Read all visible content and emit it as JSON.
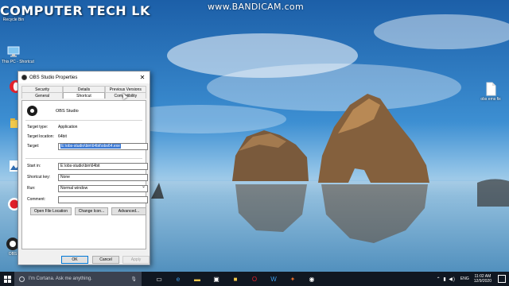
{
  "watermark": "COMPUTER TECH LK",
  "recorder_watermark": "www.BANDICAM.com",
  "desktop": {
    "icons": [
      {
        "label": "Recycle Bin"
      },
      {
        "label": "This PC - Shortcut"
      },
      {
        "label": "obs ems fix"
      }
    ]
  },
  "dialog": {
    "title": "OBS Studio Properties",
    "close_glyph": "✕",
    "tabs_row1": [
      "Security",
      "Details",
      "Previous Versions"
    ],
    "tabs_row2": [
      "General",
      "Shortcut",
      "Compatibility"
    ],
    "active_tab": "Compatibility",
    "app_name": "OBS Studio",
    "target_type_label": "Target type:",
    "target_type_value": "Application",
    "target_location_label": "Target location:",
    "target_location_value": "64bit",
    "target_label": "Target:",
    "target_value": "E:\\obs-studio\\bin\\64bit\\obs64.exe",
    "start_in_label": "Start in:",
    "start_in_value": "E:\\obs-studio\\bin\\64bit",
    "shortcut_key_label": "Shortcut key:",
    "shortcut_key_value": "None",
    "run_label": "Run:",
    "run_value": "Normal window",
    "comment_label": "Comment:",
    "comment_value": "",
    "open_file_location": "Open File Location",
    "change_icon": "Change Icon...",
    "advanced": "Advanced...",
    "ok": "OK",
    "cancel": "Cancel",
    "apply": "Apply"
  },
  "taskbar": {
    "search_placeholder": "I'm Cortana. Ask me anything.",
    "language": "ENG",
    "time": "11:02 AM",
    "date": "12/9/2020"
  }
}
